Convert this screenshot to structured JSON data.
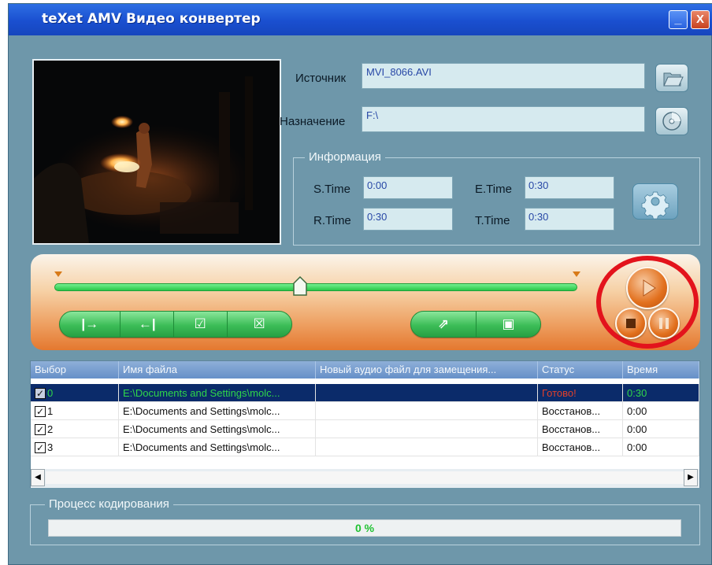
{
  "window": {
    "title": "teXet AMV Видео конвертер",
    "minimize_glyph": "_",
    "close_glyph": "X"
  },
  "source": {
    "label": "Источник",
    "value": "MVI_8066.AVI",
    "icon": "folder-open-icon"
  },
  "destination": {
    "label": "Назначение",
    "value": "F:\\",
    "icon": "disc-icon"
  },
  "info": {
    "title": "Информация",
    "stime_label": "S.Time",
    "stime_value": "0:00",
    "etime_label": "E.Time",
    "etime_value": "0:30",
    "rtime_label": "R.Time",
    "rtime_value": "0:30",
    "ttime_label": "T.Time",
    "ttime_value": "0:30",
    "settings_icon": "gear-icon"
  },
  "timeline": {
    "position": 0.47,
    "buttons_left": [
      "|→",
      "←|",
      "☑",
      "☒"
    ],
    "buttons_right": [
      "⇗",
      "▣"
    ]
  },
  "playback": {
    "play_icon": "play-icon",
    "stop_icon": "stop-icon",
    "pause_icon": "pause-icon"
  },
  "table": {
    "headers": [
      "Выбор",
      "Имя файла",
      "Новый аудио файл для замещения...",
      "Статус",
      "Время"
    ],
    "rows": [
      {
        "num": "0",
        "file": "E:\\Documents and Settings\\molc...",
        "audio": "",
        "status": "Готово!",
        "time": "0:30"
      },
      {
        "num": "1",
        "file": "E:\\Documents and Settings\\molc...",
        "audio": "",
        "status": "Восстанов...",
        "time": "0:00"
      },
      {
        "num": "2",
        "file": "E:\\Documents and Settings\\molc...",
        "audio": "",
        "status": "Восстанов...",
        "time": "0:00"
      },
      {
        "num": "3",
        "file": "E:\\Documents and Settings\\molc...",
        "audio": "",
        "status": "Восстанов...",
        "time": "0:00"
      }
    ]
  },
  "encoding": {
    "title": "Процесс кодирования",
    "progress_text": "0 %",
    "progress": 0
  },
  "colors": {
    "accent_green": "#29c848",
    "accent_orange": "#e4782f",
    "highlight_ring": "#e3131c"
  }
}
